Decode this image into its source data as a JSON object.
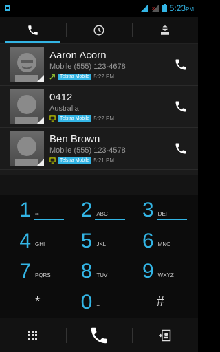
{
  "status_bar": {
    "time": "5:23",
    "ampm": "PM",
    "icons": [
      "notification-icon",
      "signal-icon",
      "signal-x-icon",
      "battery-icon"
    ]
  },
  "tabs": [
    {
      "icon": "phone-icon",
      "active": true
    },
    {
      "icon": "clock-icon",
      "active": false
    },
    {
      "icon": "contact-icon",
      "active": false
    }
  ],
  "calls": [
    {
      "name": "Aaron Acorn",
      "number": "Mobile (555) 123-4678",
      "sim": "Telstra Mobile",
      "time": "5:22 PM",
      "type": "outgoing"
    },
    {
      "name": "0412",
      "number": "Australia",
      "sim": "Telstra Mobile",
      "time": "5:22 PM",
      "type": "missed"
    },
    {
      "name": "Ben Brown",
      "number": "Mobile (555) 123-4578",
      "sim": "Telstra Mobile",
      "time": "5:21 PM",
      "type": "missed"
    }
  ],
  "dialpad": [
    {
      "digit": "1",
      "letters": "∞"
    },
    {
      "digit": "2",
      "letters": "ABC"
    },
    {
      "digit": "3",
      "letters": "DEF"
    },
    {
      "digit": "4",
      "letters": "GHI"
    },
    {
      "digit": "5",
      "letters": "JKL"
    },
    {
      "digit": "6",
      "letters": "MNO"
    },
    {
      "digit": "7",
      "letters": "PQRS"
    },
    {
      "digit": "8",
      "letters": "TUV"
    },
    {
      "digit": "9",
      "letters": "WXYZ"
    },
    {
      "digit": "*",
      "letters": ""
    },
    {
      "digit": "0",
      "letters": "+"
    },
    {
      "digit": "#",
      "letters": ""
    }
  ],
  "actions": [
    "dialpad-grid-icon",
    "call-icon",
    "add-contact-icon"
  ],
  "colors": {
    "accent": "#33b5e5",
    "call_green": "#ffffff",
    "outgoing": "#9acd32",
    "missed": "#c8d400"
  }
}
